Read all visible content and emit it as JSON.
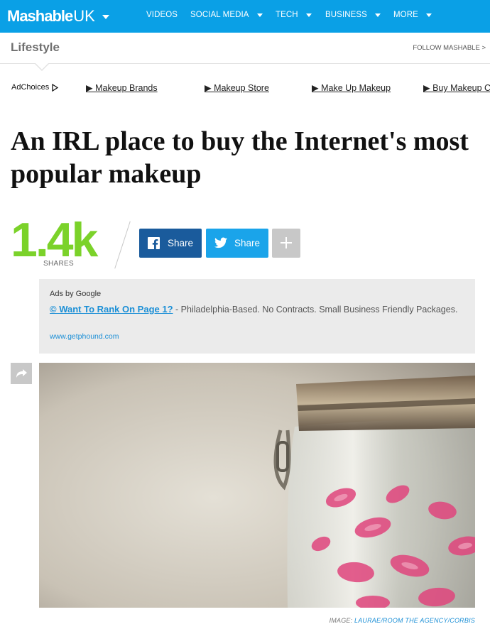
{
  "nav": {
    "brand": "Mashable",
    "region": "UK",
    "items": [
      {
        "label": "VIDEOS",
        "has_menu": false
      },
      {
        "label": "SOCIAL MEDIA",
        "has_menu": true
      },
      {
        "label": "TECH",
        "has_menu": true
      },
      {
        "label": "BUSINESS",
        "has_menu": true
      },
      {
        "label": "MORE",
        "has_menu": true
      }
    ],
    "accent_color": "#0aa0e6"
  },
  "subheader": {
    "section": "Lifestyle",
    "follow": "FOLLOW MASHABLE >"
  },
  "ad_links": {
    "adchoices": "AdChoices",
    "links": [
      "▶ Makeup Brands",
      "▶ Makeup Store",
      "▶ Make Up Makeup",
      "▶ Buy Makeup C"
    ]
  },
  "article": {
    "headline": "An IRL place to buy the Internet's most popular makeup",
    "share_count": "1.4k",
    "shares_label": "SHARES",
    "facebook_label": "Share",
    "twitter_label": "Share",
    "share_count_color": "#7bd22a"
  },
  "google_ad": {
    "by": "Ads by Google",
    "title": "© Want To Rank On Page 1?",
    "text": " - Philadelphia-Based. No Contracts. Small Business Friendly Packages.",
    "url": "www.getphound.com"
  },
  "image": {
    "credit_prefix": "IMAGE: ",
    "credit_link": "LAURAE/ROOM THE AGENCY/CORBIS"
  }
}
